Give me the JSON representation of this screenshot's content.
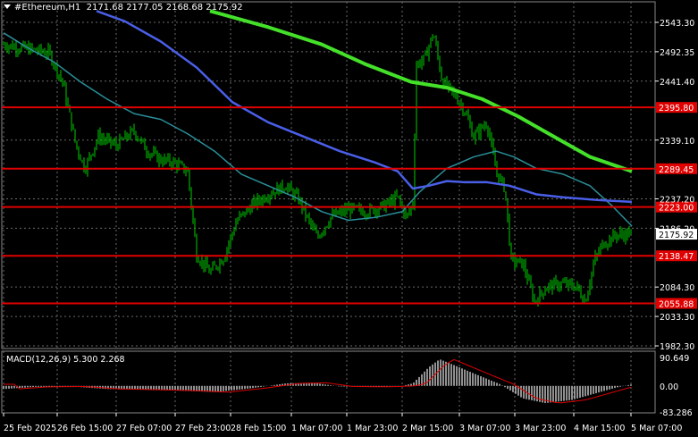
{
  "header": {
    "symbol": "#Ethereum,H1",
    "ohlc": "2171.68 2177.05 2168.68 2175.92"
  },
  "price_axis": {
    "ticks": [
      "2543.30",
      "2492.35",
      "2441.40",
      "2339.10",
      "2237.20",
      "2186.20",
      "2084.30",
      "2033.30",
      "1982.30"
    ]
  },
  "horizontal_levels": [
    {
      "label": "2395.80",
      "value": 2395.8
    },
    {
      "label": "2289.45",
      "value": 2289.45
    },
    {
      "label": "2223.00",
      "value": 2223.0
    },
    {
      "label": "2138.47",
      "value": 2138.47
    },
    {
      "label": "2055.88",
      "value": 2055.88
    }
  ],
  "current_price": {
    "label": "2175.92",
    "value": 2175.92
  },
  "time_axis": {
    "ticks": [
      "25 Feb 2025",
      "26 Feb 15:00",
      "27 Feb 07:00",
      "27 Feb 23:00",
      "28 Feb 15:00",
      "1 Mar 07:00",
      "1 Mar 23:00",
      "2 Mar 15:00",
      "3 Mar 07:00",
      "3 Mar 23:00",
      "4 Mar 15:00",
      "5 Mar 07:00"
    ]
  },
  "macd": {
    "label": "MACD(12,26,9) 5.300 2.268",
    "ticks": [
      "90.649",
      "0.00",
      "-83.286"
    ]
  },
  "colors": {
    "background": "#000000",
    "candle": "#00cc00",
    "level_line": "#e00000",
    "level_tag": "#e00000",
    "ma_fast": "#2a8f9a",
    "ma_mid": "#4a5fe8",
    "ma_slow": "#44e02a",
    "macd_hist": "#c0c0c0",
    "macd_signal": "#e00000",
    "grid": "#6a6a6a"
  }
}
